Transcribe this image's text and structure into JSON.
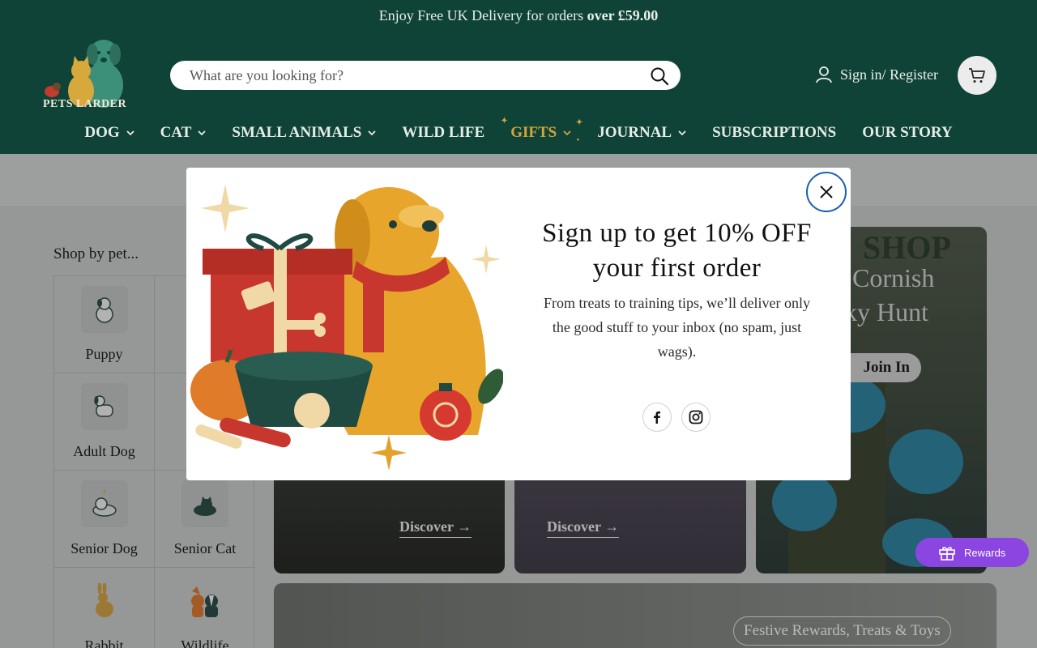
{
  "announcement": {
    "text": "Enjoy Free UK Delivery for orders ",
    "bold": "over £59.00"
  },
  "logo": {
    "text": "PETS LARDER"
  },
  "search": {
    "placeholder": "What are you looking for?"
  },
  "account": {
    "label": "Sign in/ Register"
  },
  "nav": [
    {
      "label": "DOG"
    },
    {
      "label": "CAT"
    },
    {
      "label": "SMALL ANIMALS"
    },
    {
      "label": "WILD LIFE"
    },
    {
      "label": "GIFTS"
    },
    {
      "label": "JOURNAL"
    },
    {
      "label": "SUBSCRIPTIONS"
    },
    {
      "label": "OUR STORY"
    }
  ],
  "shop_by": {
    "heading": "Shop by pet...",
    "items": [
      "Puppy",
      "Adult Dog",
      "Senior Dog",
      "Senior Cat",
      "Rabbit",
      "Wildlife"
    ]
  },
  "cards": {
    "dog_discover": "Discover →",
    "cat_discover": "Discover →",
    "shop_sign": "SHOP",
    "cornish_line1": "Cornish",
    "cornish_line2": "ky Hunt",
    "join": "Join In"
  },
  "banner": {
    "pill": "Festive Rewards, Treats & Toys"
  },
  "rewards": {
    "label": "Rewards"
  },
  "modal": {
    "title": "Sign up to get 10% OFF your first order",
    "text": "From treats to training tips, we’ll deliver only the good stuff to your inbox (no spam, just wags)."
  },
  "colors": {
    "header": "#0f4337",
    "gifts": "#d4a43a",
    "rewards": "#8b45e0",
    "close_ring": "#1a5fb4"
  }
}
